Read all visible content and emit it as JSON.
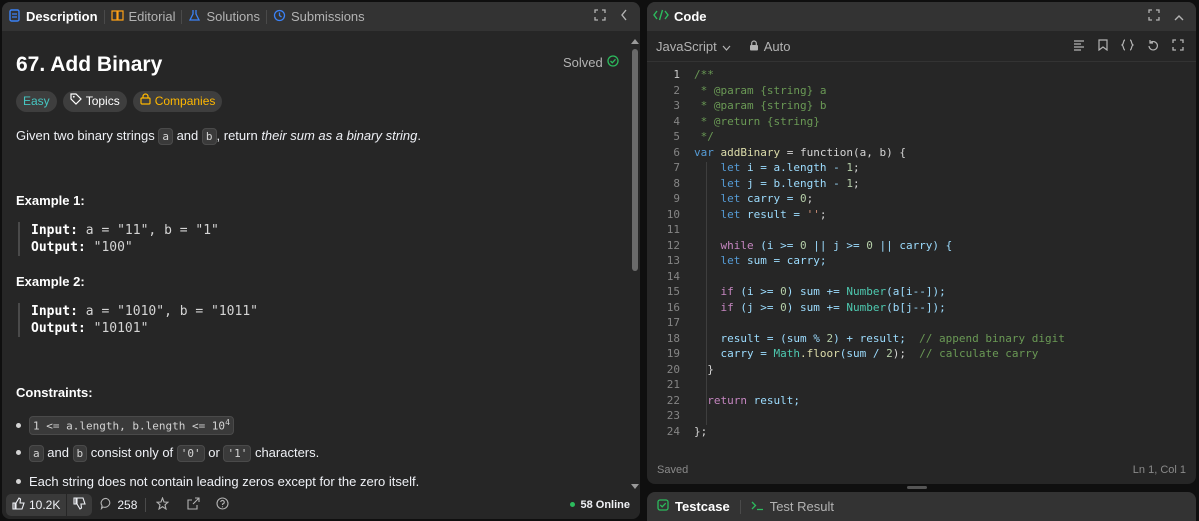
{
  "left_tabs": [
    {
      "label": "Description",
      "icon": "description-icon"
    },
    {
      "label": "Editorial",
      "icon": "book-icon"
    },
    {
      "label": "Solutions",
      "icon": "flask-icon"
    },
    {
      "label": "Submissions",
      "icon": "history-icon"
    }
  ],
  "problem": {
    "title": "67. Add Binary",
    "status": "Solved",
    "tags": [
      "Easy",
      "Topics",
      "Companies"
    ],
    "desc_pre": "Given two binary strings ",
    "desc_a": "a",
    "desc_and": " and ",
    "desc_b": "b",
    "desc_mid": ", return ",
    "desc_em": "their sum as a binary string",
    "desc_end": "."
  },
  "examples": [
    {
      "heading": "Example 1:",
      "input_label": "Input:",
      "input": "a = \"11\", b = \"1\"",
      "output_label": "Output:",
      "output": "\"100\""
    },
    {
      "heading": "Example 2:",
      "input_label": "Input:",
      "input": "a = \"1010\", b = \"1011\"",
      "output_label": "Output:",
      "output": "\"10101\""
    }
  ],
  "constraints": {
    "heading": "Constraints:",
    "c1": "1 <= a.length, b.length <= 10",
    "c1_sup": "4",
    "c2_a": "a",
    "c2_and": " and ",
    "c2_b": "b",
    "c2_mid": " consist only of ",
    "c2_zero": "'0'",
    "c2_or": " or ",
    "c2_one": "'1'",
    "c2_end": " characters.",
    "c3": "Each string does not contain leading zeros except for the zero itself."
  },
  "footer": {
    "likes": "10.2K",
    "comments": "258",
    "online": "58 Online"
  },
  "code_panel": {
    "title": "Code",
    "language": "JavaScript",
    "mode": "Auto",
    "status_left": "Saved",
    "status_right": "Ln 1, Col 1"
  },
  "code_lines": [
    "1",
    "2",
    "3",
    "4",
    "5",
    "6",
    "7",
    "8",
    "9",
    "10",
    "11",
    "12",
    "13",
    "14",
    "15",
    "16",
    "17",
    "18",
    "19",
    "20",
    "21",
    "22",
    "23",
    "24"
  ],
  "code": {
    "l1": "/**",
    "l2": " * @param {string} a",
    "l3": " * @param {string} b",
    "l4": " * @return {string}",
    "l5": " */",
    "l6_kw": "var",
    "l6_fn": " addBinary",
    "l6_rest": " = function(a, b) {",
    "l7_kw": "    let",
    "l7_rest": " i = a.length - ",
    "l7_num": "1",
    "l7_end": ";",
    "l8_kw": "    let",
    "l8_rest": " j = b.length - ",
    "l8_num": "1",
    "l8_end": ";",
    "l9_kw": "    let",
    "l9_rest": " carry = ",
    "l9_num": "0",
    "l9_end": ";",
    "l10_kw": "    let",
    "l10_rest": " result = ",
    "l10_str": "''",
    "l10_end": ";",
    "l12_kw": "    while",
    "l12_rest": " (i >= ",
    "l12_n1": "0",
    "l12_mid": " || j >= ",
    "l12_n2": "0",
    "l12_end": " || carry) {",
    "l13_kw": "    let",
    "l13_rest": " sum = carry;",
    "l15_kw": "    if",
    "l15_rest": " (i >= ",
    "l15_num": "0",
    "l15_mid": ") sum += ",
    "l15_fn": "Number",
    "l15_end": "(a[i--]);",
    "l16_kw": "    if",
    "l16_rest": " (j >= ",
    "l16_num": "0",
    "l16_mid": ") sum += ",
    "l16_fn": "Number",
    "l16_end": "(b[j--]);",
    "l18_a": "    result = (sum % ",
    "l18_num": "2",
    "l18_b": ") + result;  ",
    "l18_com": "// append binary digit",
    "l19_a": "    carry = ",
    "l19_cls": "Math",
    "l19_fn": ".floor",
    "l19_b": "(sum / ",
    "l19_num": "2",
    "l19_c": ");  ",
    "l19_com": "// calculate carry",
    "l20": "  }",
    "l22_kw": "  return",
    "l22_rest": " result;",
    "l24": "};"
  },
  "bottom_tabs": [
    {
      "label": "Testcase",
      "icon": "checkbox-icon"
    },
    {
      "label": "Test Result",
      "icon": "terminal-icon"
    }
  ],
  "colors": {
    "accent_green": "#2cbb5d",
    "easy": "#46c6c2",
    "companies": "#ffb800"
  }
}
